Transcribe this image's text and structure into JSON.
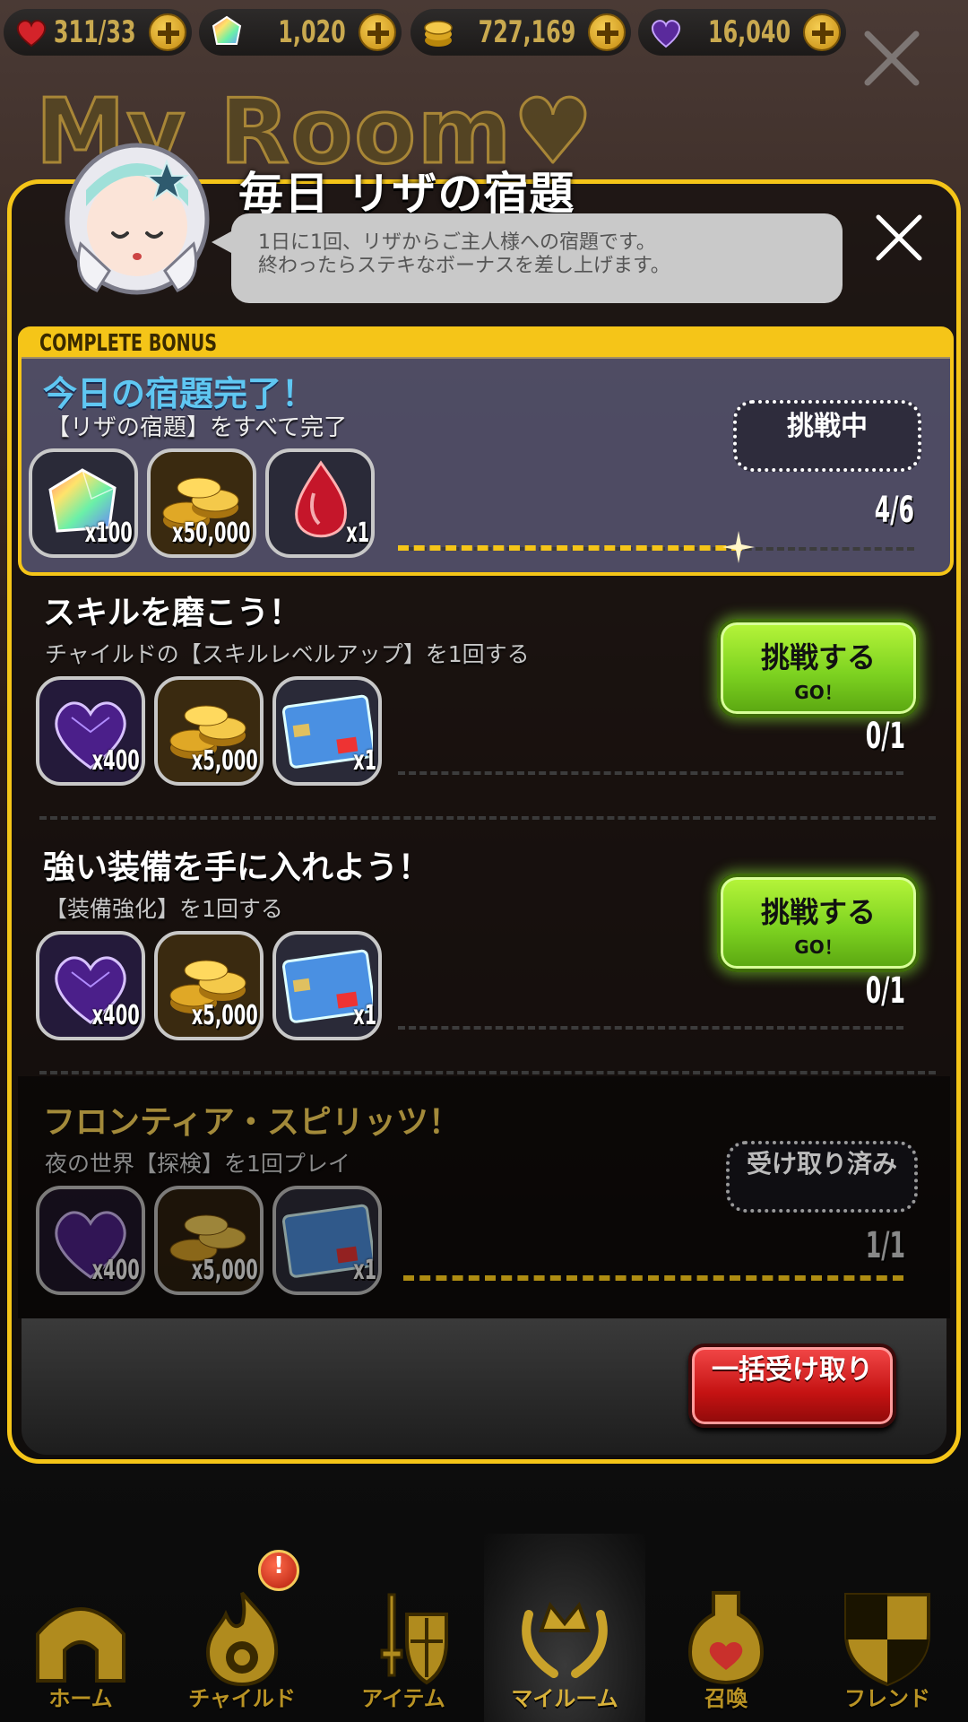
{
  "resources": [
    {
      "icon": "heart-icon",
      "value": "311/33"
    },
    {
      "icon": "rainbow-gem-icon",
      "value": "1,020"
    },
    {
      "icon": "gold-coin-icon",
      "value": "727,169"
    },
    {
      "icon": "purple-heart-gem-icon",
      "value": "16,040"
    }
  ],
  "background": {
    "logo": "My Room♥"
  },
  "modal": {
    "title": "毎日 リザの宿題",
    "speech_line1": "1日に1回、リザからご主人様への宿題です。",
    "speech_line2": "終わったらステキなボーナスを差し上げます。"
  },
  "complete_bonus": {
    "tab_label": "COMPLETE BONUS",
    "title": "今日の宿題完了！",
    "description": "【リザの宿題】をすべて完了",
    "rewards": [
      {
        "icon": "rainbow-gem-icon",
        "qty": "x100"
      },
      {
        "icon": "gold-coin-pile-icon",
        "qty": "x50,000"
      },
      {
        "icon": "red-crystal-icon",
        "qty": "x1"
      }
    ],
    "status_label": "挑戦中",
    "progress_text": "4/6",
    "progress": 0.6667
  },
  "tasks": [
    {
      "title": "スキルを磨こう！",
      "description": "チャイルドの【スキルレベルアップ】を1回する",
      "rewards": [
        {
          "icon": "purple-heart-gem-icon",
          "qty": "x400"
        },
        {
          "icon": "gold-coin-pile-icon",
          "qty": "x5,000"
        },
        {
          "icon": "bank-card-icon",
          "qty": "x1"
        }
      ],
      "button_line1": "挑戦する",
      "button_line2": "GO！",
      "progress_text": "0/1"
    },
    {
      "title": "強い装備を手に入れよう！",
      "description": "【装備強化】を1回する",
      "rewards": [
        {
          "icon": "purple-heart-gem-icon",
          "qty": "x400"
        },
        {
          "icon": "gold-coin-pile-icon",
          "qty": "x5,000"
        },
        {
          "icon": "bank-card-icon",
          "qty": "x1"
        }
      ],
      "button_line1": "挑戦する",
      "button_line2": "GO！",
      "progress_text": "0/1"
    },
    {
      "title": "フロンティア・スピリッツ！",
      "description": "夜の世界【探検】を1回プレイ",
      "rewards": [
        {
          "icon": "purple-heart-gem-icon",
          "qty": "x400"
        },
        {
          "icon": "gold-coin-pile-icon",
          "qty": "x5,000"
        },
        {
          "icon": "bank-card-icon",
          "qty": "x1"
        }
      ],
      "button_label": "受け取り済み",
      "progress_text": "1/1"
    }
  ],
  "footer": {
    "claim_all_label": "一括受け取り"
  },
  "nav": {
    "items": [
      {
        "label": "ホーム",
        "icon": "home-icon"
      },
      {
        "label": "チャイルド",
        "icon": "flame-icon"
      },
      {
        "label": "アイテム",
        "icon": "sword-shield-icon"
      },
      {
        "label": "マイルーム",
        "icon": "crown-laurel-icon"
      },
      {
        "label": "召喚",
        "icon": "potion-bottle-icon"
      },
      {
        "label": "フレンド",
        "icon": "shield-icon"
      }
    ],
    "badge": "!",
    "active": "マイルーム"
  },
  "colors": {
    "accent": "#f5c518",
    "go_button": "#7ed321",
    "claim_button": "#c41212",
    "bonus_title": "#5fc7f2"
  }
}
